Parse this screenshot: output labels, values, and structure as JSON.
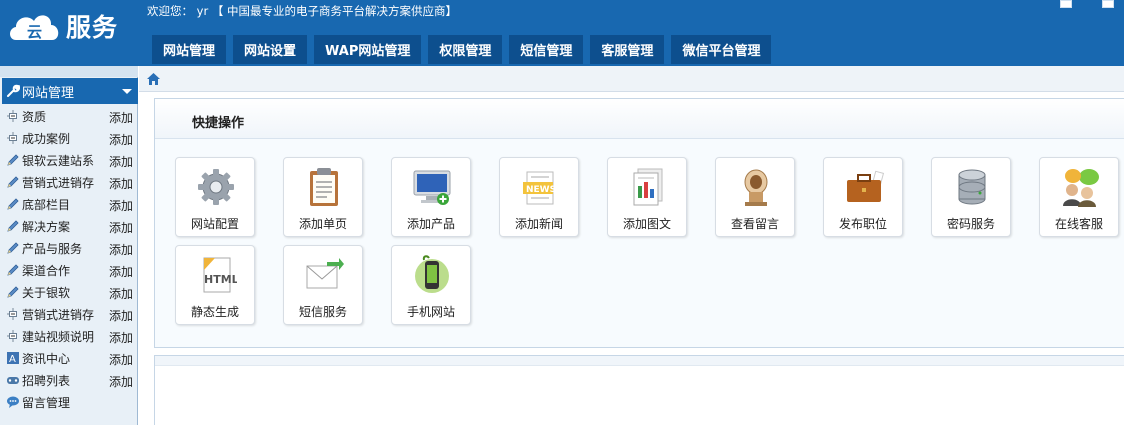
{
  "header": {
    "logo_text": "服务",
    "welcome": "欢迎您： yr 【 中国最专业的电子商务平台解决方案供应商】",
    "nav_tabs": [
      "网站管理",
      "网站设置",
      "WAP网站管理",
      "权限管理",
      "短信管理",
      "客服管理",
      "微信平台管理"
    ]
  },
  "sidebar": {
    "title": "网站管理",
    "items": [
      {
        "label": "资质",
        "add": "添加",
        "icon": "tree-node-icon"
      },
      {
        "label": "成功案例",
        "add": "添加",
        "icon": "tree-node-icon"
      },
      {
        "label": "银软云建站系",
        "add": "添加",
        "icon": "pencil-icon"
      },
      {
        "label": "营销式进销存",
        "add": "添加",
        "icon": "pencil-icon"
      },
      {
        "label": "底部栏目",
        "add": "添加",
        "icon": "pencil-icon"
      },
      {
        "label": "解决方案",
        "add": "添加",
        "icon": "pencil-icon"
      },
      {
        "label": "产品与服务",
        "add": "添加",
        "icon": "pencil-icon"
      },
      {
        "label": "渠道合作",
        "add": "添加",
        "icon": "pencil-icon"
      },
      {
        "label": "关于银软",
        "add": "添加",
        "icon": "pencil-icon"
      },
      {
        "label": "营销式进销存",
        "add": "添加",
        "icon": "tree-node-icon"
      },
      {
        "label": "建站视频说明",
        "add": "添加",
        "icon": "tree-node-icon"
      },
      {
        "label": "资讯中心",
        "add": "添加",
        "icon": "news-icon"
      },
      {
        "label": "招聘列表",
        "add": "添加",
        "icon": "gamepad-icon"
      },
      {
        "label": "留言管理",
        "add": "",
        "icon": "chat-icon"
      }
    ]
  },
  "panel": {
    "title": "快捷操作",
    "tiles": [
      {
        "label": "网站配置",
        "icon": "gear-icon"
      },
      {
        "label": "添加单页",
        "icon": "clipboard-icon"
      },
      {
        "label": "添加产品",
        "icon": "monitor-icon"
      },
      {
        "label": "添加新闻",
        "icon": "news-icon"
      },
      {
        "label": "添加图文",
        "icon": "document-chart-icon"
      },
      {
        "label": "查看留言",
        "icon": "message-icon"
      },
      {
        "label": "发布职位",
        "icon": "briefcase-icon"
      },
      {
        "label": "密码服务",
        "icon": "database-icon"
      },
      {
        "label": "在线客服",
        "icon": "support-chat-icon"
      },
      {
        "label": "静态生成",
        "icon": "html-icon"
      },
      {
        "label": "短信服务",
        "icon": "mail-icon"
      },
      {
        "label": "手机网站",
        "icon": "mobile-icon"
      }
    ]
  },
  "colors": {
    "header_bg": "#1868b0",
    "tab_bg": "#0d4f8e",
    "sidebar_bg": "#e8f0f7"
  }
}
